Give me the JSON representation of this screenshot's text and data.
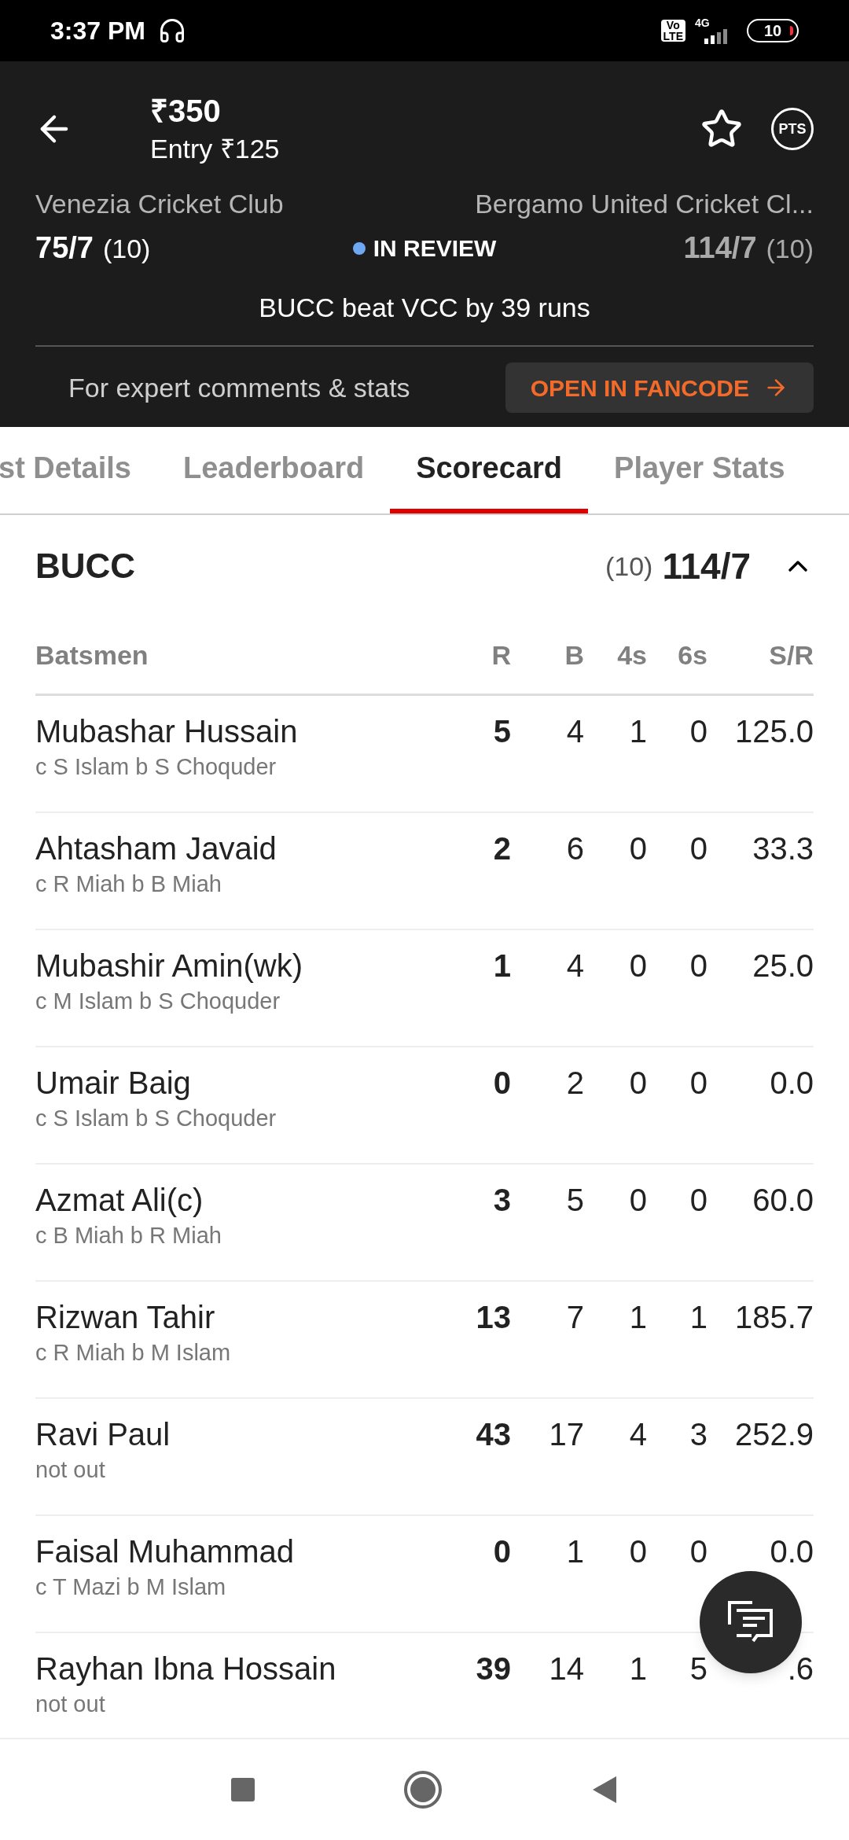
{
  "status_bar": {
    "time": "3:37 PM",
    "volte": [
      "Vo",
      "LTE"
    ],
    "network": "4G",
    "battery": "10"
  },
  "header": {
    "prize": "₹350",
    "entry": "Entry ₹125",
    "pts": "PTS"
  },
  "match": {
    "team_1": {
      "name": "Venezia Cricket Club",
      "score": "75/7",
      "overs": "(10)"
    },
    "status": "IN REVIEW",
    "team_2": {
      "name": "Bergamo United Cricket Cl...",
      "score": "114/7",
      "overs": "(10)"
    },
    "result": "BUCC beat VCC by 39 runs"
  },
  "promo": {
    "text": "For expert comments & stats",
    "button": "OPEN IN FANCODE"
  },
  "tabs": [
    {
      "label": "st Details",
      "selected": false
    },
    {
      "label": "Leaderboard",
      "selected": false
    },
    {
      "label": "Scorecard",
      "selected": true
    },
    {
      "label": "Player Stats",
      "selected": false
    }
  ],
  "innings": {
    "team": "BUCC",
    "overs": "(10)",
    "score": "114/7",
    "expanded": true
  },
  "table": {
    "columns": [
      "Batsmen",
      "R",
      "B",
      "4s",
      "6s",
      "S/R"
    ],
    "rows": [
      {
        "name": "Mubashar Hussain",
        "dismissal": "c S Islam b S Choquder",
        "r": "5",
        "b": "4",
        "fours": "1",
        "sixes": "0",
        "sr": "125.0"
      },
      {
        "name": "Ahtasham Javaid",
        "dismissal": "c R Miah b B Miah",
        "r": "2",
        "b": "6",
        "fours": "0",
        "sixes": "0",
        "sr": "33.3"
      },
      {
        "name": "Mubashir Amin(wk)",
        "dismissal": "c M Islam b S Choquder",
        "r": "1",
        "b": "4",
        "fours": "0",
        "sixes": "0",
        "sr": "25.0"
      },
      {
        "name": "Umair Baig",
        "dismissal": "c S Islam b S Choquder",
        "r": "0",
        "b": "2",
        "fours": "0",
        "sixes": "0",
        "sr": "0.0"
      },
      {
        "name": "Azmat Ali(c)",
        "dismissal": "c B Miah b R Miah",
        "r": "3",
        "b": "5",
        "fours": "0",
        "sixes": "0",
        "sr": "60.0"
      },
      {
        "name": "Rizwan Tahir",
        "dismissal": "c R Miah b M Islam",
        "r": "13",
        "b": "7",
        "fours": "1",
        "sixes": "1",
        "sr": "185.7"
      },
      {
        "name": "Ravi Paul",
        "dismissal": "not out",
        "r": "43",
        "b": "17",
        "fours": "4",
        "sixes": "3",
        "sr": "252.9"
      },
      {
        "name": "Faisal Muhammad",
        "dismissal": "c T Mazi b M Islam",
        "r": "0",
        "b": "1",
        "fours": "0",
        "sixes": "0",
        "sr": "0.0"
      },
      {
        "name": "Rayhan Ibna Hossain",
        "dismissal": "not out",
        "r": "39",
        "b": "14",
        "fours": "1",
        "sixes": "5",
        "sr": ".6"
      }
    ]
  }
}
